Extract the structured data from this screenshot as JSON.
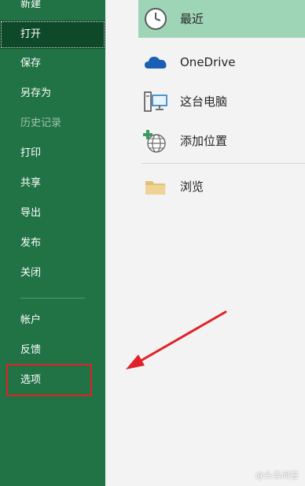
{
  "sidebar": {
    "items": [
      {
        "label": "新建"
      },
      {
        "label": "打开"
      },
      {
        "label": "保存"
      },
      {
        "label": "另存为"
      },
      {
        "label": "历史记录"
      },
      {
        "label": "打印"
      },
      {
        "label": "共享"
      },
      {
        "label": "导出"
      },
      {
        "label": "发布"
      },
      {
        "label": "关闭"
      },
      {
        "label": "帐户"
      },
      {
        "label": "反馈"
      },
      {
        "label": "选项"
      }
    ]
  },
  "locations": [
    {
      "label": "最近",
      "icon": "clock-icon"
    },
    {
      "label": "OneDrive",
      "icon": "cloud-icon"
    },
    {
      "label": "这台电脑",
      "icon": "computer-icon"
    },
    {
      "label": "添加位置",
      "icon": "globe-add-icon"
    },
    {
      "label": "浏览",
      "icon": "folder-icon"
    }
  ],
  "watermark": "@头条问答",
  "colors": {
    "sidebar_bg": "#217346",
    "sidebar_active": "#0e4a2a",
    "selected_location": "#9fd5b7",
    "annotation_red": "#e02127"
  }
}
